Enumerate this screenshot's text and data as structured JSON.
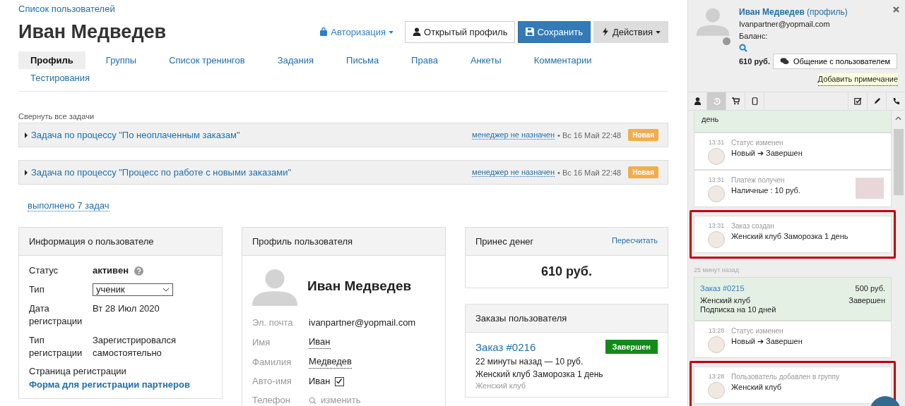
{
  "breadcrumb": "Список пользователей",
  "title": "Иван Медведев",
  "actions": [
    {
      "kind": "auth",
      "label": "Авторизация"
    },
    {
      "kind": "profile",
      "label": "Открытый профиль"
    },
    {
      "kind": "save",
      "label": "Сохранить"
    },
    {
      "kind": "menu",
      "label": "Действия"
    }
  ],
  "tabs": [
    {
      "label": "Профиль",
      "selected": true
    },
    {
      "label": "Группы",
      "selected": false
    },
    {
      "label": "Список тренингов",
      "selected": false
    },
    {
      "label": "Задания",
      "selected": false
    },
    {
      "label": "Письма",
      "selected": false
    },
    {
      "label": "Права",
      "selected": false
    },
    {
      "label": "Анкеты",
      "selected": false
    },
    {
      "label": "Комментарии",
      "selected": false
    },
    {
      "label": "Тестирования",
      "selected": false
    }
  ],
  "collapse_link": "Свернуть все задачи",
  "tasks": [
    {
      "title": "Задача по процессу \"По неоплаченным заказам\"",
      "manager": "менеджер не назначен",
      "date": "• Вс 16 Май 22:48",
      "badge": "Новая"
    },
    {
      "title": "Задача по процессу \"Процесс по работе с новыми заказами\"",
      "manager": "менеджер не назначен",
      "date": "• Вс 16 Май 22:48",
      "badge": "Новая"
    }
  ],
  "done_link": "выполнено 7 задач",
  "user_info": {
    "title": "Информация о пользователе",
    "rows": [
      {
        "kind": "status",
        "label": "Статус",
        "value": "активен"
      },
      {
        "kind": "select",
        "label": "Тип",
        "value": "ученик"
      },
      {
        "kind": "text",
        "label": "Дата регистрации",
        "value": "Вт 28 Июл 2020"
      },
      {
        "kind": "text",
        "label": "Тип регистрации",
        "value": "Зарегистрировался самостоятельно"
      }
    ],
    "reg_page_label": "Страница регистрации",
    "reg_page_link": "Форма для регистрации партнеров"
  },
  "user_profile": {
    "title": "Профиль пользователя",
    "name": "Иван Медведев",
    "rows": [
      {
        "kind": "text",
        "label": "Эл. почта",
        "value": "ivanpartner@yopmail.com"
      },
      {
        "kind": "editable",
        "label": "Имя",
        "value": "Иван"
      },
      {
        "kind": "editable",
        "label": "Фамилия",
        "value": "Медведев"
      },
      {
        "kind": "checkbox",
        "label": "Авто-имя",
        "value": "Иван",
        "checked": true
      },
      {
        "kind": "action",
        "label": "Телефон",
        "value": "изменить"
      }
    ]
  },
  "money": {
    "title": "Принес денег",
    "action": "Пересчитать",
    "amount": "610 руб."
  },
  "orders": {
    "title": "Заказы пользователя",
    "items": [
      {
        "number": "Заказ #0216",
        "status": "Завершен",
        "meta": "22 минуты назад — 10 руб.",
        "product": "Женский клуб Заморозка 1 день",
        "group": "Женский клуб"
      }
    ]
  },
  "side": {
    "name": "Иван Медведев",
    "profile_link": "(профиль)",
    "email": "Ivanpartner@yopmail.com",
    "balance_label": "Баланс:",
    "balance": "610 руб.",
    "chat_button": "Общение с пользователем",
    "note_link": "Добавить примечание",
    "tabs": [
      {
        "kind": "user",
        "selected": false
      },
      {
        "kind": "history",
        "selected": true
      },
      {
        "kind": "cart",
        "selected": false
      },
      {
        "kind": "device",
        "selected": false
      },
      {
        "kind": "task",
        "selected": false
      },
      {
        "kind": "edit",
        "selected": false
      },
      {
        "kind": "phone",
        "selected": false
      }
    ],
    "feed": [
      {
        "kind": "tail",
        "text": "день"
      },
      {
        "kind": "event",
        "time": "13:31",
        "title": "Статус изменен",
        "text": "Новый ➔ Завершен",
        "highlighted": false,
        "thumbnail": false
      },
      {
        "kind": "event",
        "time": "13:31",
        "title": "Платеж получен",
        "text": "Наличные : 10 руб.",
        "highlighted": false,
        "thumbnail": true
      },
      {
        "kind": "event",
        "time": "13:31",
        "title": "Заказ создан",
        "text": "Женский клуб Заморозка 1 день",
        "highlighted": true,
        "thumbnail": false
      },
      {
        "kind": "ago",
        "text": "25 минут назад"
      },
      {
        "kind": "order",
        "number": "Заказ #0215",
        "amount": "500 руб.",
        "product": "Женский клуб Подписка на 10 дней",
        "status": "Завершен"
      },
      {
        "kind": "event",
        "time": "13:28",
        "title": "Статус изменен",
        "text": "Новый ➔ Завершен",
        "highlighted": false,
        "thumbnail": false
      },
      {
        "kind": "event",
        "time": "13:28",
        "title": "Пользователь добавлен в группу",
        "text": "Женский клуб",
        "highlighted": true,
        "thumbnail": false
      }
    ]
  }
}
